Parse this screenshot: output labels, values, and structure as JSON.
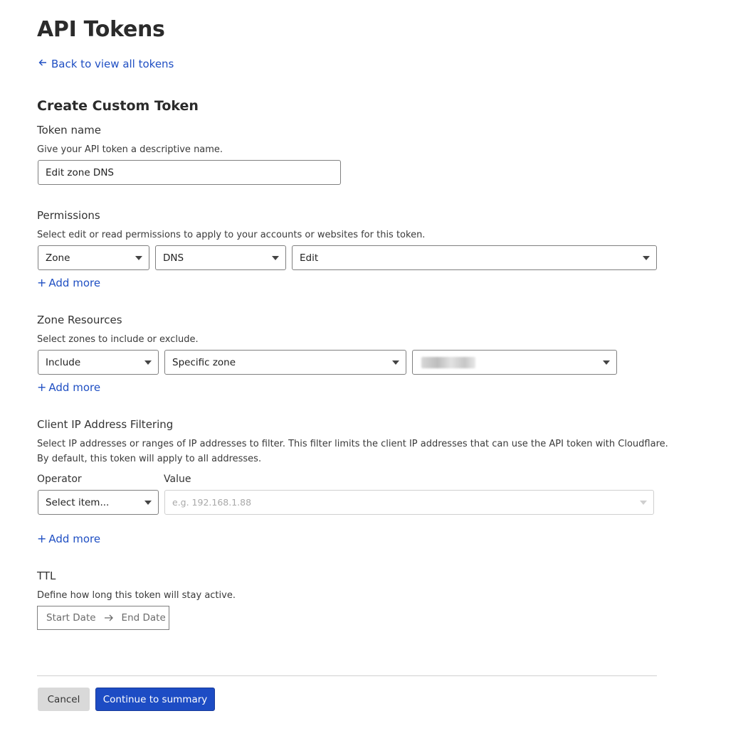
{
  "page": {
    "title": "API Tokens",
    "back_link": "Back to view all tokens",
    "section_title": "Create Custom Token"
  },
  "token_name": {
    "label": "Token name",
    "help": "Give your API token a descriptive name.",
    "value": "Edit zone DNS"
  },
  "permissions": {
    "label": "Permissions",
    "help": "Select edit or read permissions to apply to your accounts or websites for this token.",
    "scope": "Zone",
    "resource": "DNS",
    "level": "Edit",
    "add_more": "Add more"
  },
  "zone_resources": {
    "label": "Zone Resources",
    "help": "Select zones to include or exclude.",
    "mode": "Include",
    "target": "Specific zone",
    "zone_value_redacted": "",
    "add_more": "Add more"
  },
  "ip_filtering": {
    "label": "Client IP Address Filtering",
    "help_line1": "Select IP addresses or ranges of IP addresses to filter. This filter limits the client IP addresses that can use the API token with Cloudflare.",
    "help_line2": "By default, this token will apply to all addresses.",
    "operator_label": "Operator",
    "value_label": "Value",
    "operator_placeholder": "Select item...",
    "value_placeholder": "e.g. 192.168.1.88",
    "add_more": "Add more"
  },
  "ttl": {
    "label": "TTL",
    "help": "Define how long this token will stay active.",
    "start_placeholder": "Start Date",
    "end_placeholder": "End Date"
  },
  "actions": {
    "cancel": "Cancel",
    "continue": "Continue to summary"
  },
  "colors": {
    "link": "#1f4fc3",
    "primary_button": "#1d4cc4",
    "secondary_button": "#d9d9d9"
  }
}
